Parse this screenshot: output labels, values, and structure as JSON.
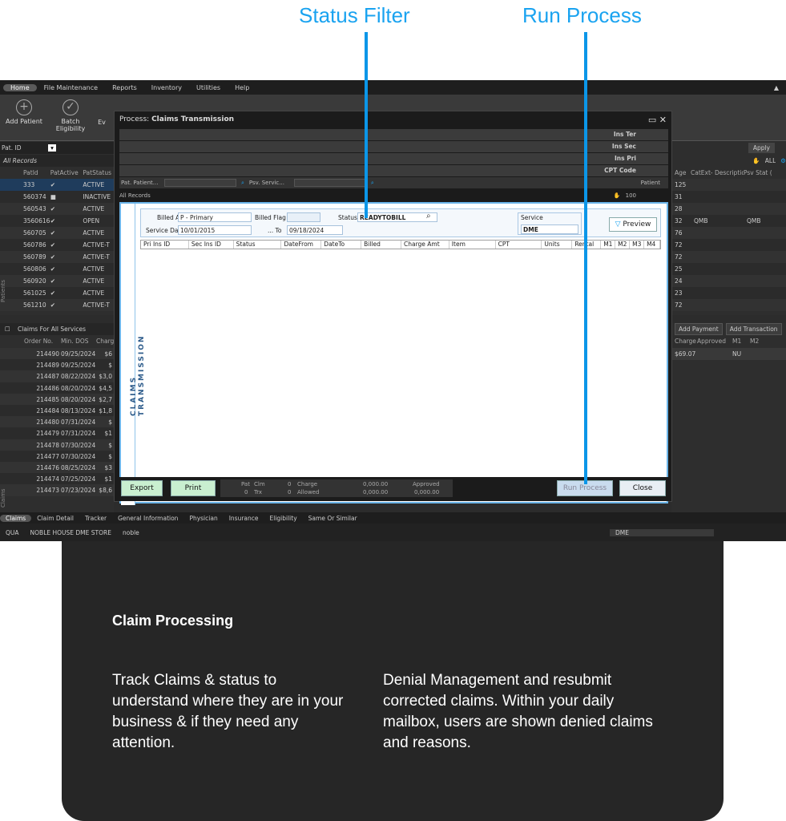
{
  "callouts": {
    "status_filter": "Status Filter",
    "run_process": "Run Process"
  },
  "menu": [
    "Home",
    "File Maintenance",
    "Reports",
    "Inventory",
    "Utilities",
    "Help"
  ],
  "ribbon": [
    "Add Patient",
    "Batch Eligibility",
    "Ev"
  ],
  "patients": {
    "search_label": "Pat. ID",
    "all_records": "All Records",
    "side_label": "Patients",
    "cols": [
      "PatId",
      "PatActive",
      "PatStatus"
    ],
    "rows": [
      [
        "333",
        "✔",
        "ACTIVE"
      ],
      [
        "560374",
        "■",
        "INACTIVE"
      ],
      [
        "560543",
        "✔",
        "ACTIVE"
      ],
      [
        "3560616",
        "✔",
        "OPEN"
      ],
      [
        "560705",
        "✔",
        "ACTIVE"
      ],
      [
        "560786",
        "✔",
        "ACTIVE-T"
      ],
      [
        "560789",
        "✔",
        "ACTIVE-T"
      ],
      [
        "560806",
        "✔",
        "ACTIVE"
      ],
      [
        "560920",
        "✔",
        "ACTIVE"
      ],
      [
        "561025",
        "✔",
        "ACTIVE"
      ],
      [
        "561210",
        "✔",
        "ACTIVE-T"
      ]
    ],
    "right_cols": [
      "Age",
      "CatExt- Description",
      "Psv Stat ("
    ],
    "right_rows": [
      [
        "125",
        "",
        ""
      ],
      [
        "31",
        "",
        ""
      ],
      [
        "28",
        "",
        ""
      ],
      [
        "32",
        "QMB",
        "QMB"
      ],
      [
        "76",
        "",
        ""
      ],
      [
        "72",
        "",
        ""
      ],
      [
        "72",
        "",
        ""
      ],
      [
        "25",
        "",
        ""
      ],
      [
        "24",
        "",
        ""
      ],
      [
        "23",
        "",
        ""
      ],
      [
        "72",
        "",
        ""
      ]
    ],
    "apply": "Apply",
    "all": "ALL"
  },
  "claims": {
    "header": "Claims For All Services",
    "side_label": "Claims",
    "cols": [
      "Order No.",
      "Min. DOS",
      "Charg"
    ],
    "rows": [
      [
        "214490",
        "09/25/2024",
        "$6"
      ],
      [
        "214489",
        "09/25/2024",
        "$"
      ],
      [
        "214487",
        "08/22/2024",
        "$3,0"
      ],
      [
        "214486",
        "08/20/2024",
        "$4,5"
      ],
      [
        "214485",
        "08/20/2024",
        "$2,7"
      ],
      [
        "214484",
        "08/13/2024",
        "$1,8"
      ],
      [
        "214480",
        "07/31/2024",
        "$"
      ],
      [
        "214479",
        "07/31/2024",
        "$1"
      ],
      [
        "214478",
        "07/30/2024",
        "$"
      ],
      [
        "214477",
        "07/30/2024",
        "$"
      ],
      [
        "214476",
        "08/25/2024",
        "$3"
      ],
      [
        "214474",
        "07/25/2024",
        "$1"
      ],
      [
        "214473",
        "07/23/2024",
        "$8,6"
      ]
    ],
    "add_payment": "Add Payment",
    "add_transaction": "Add Transaction",
    "right_cols": [
      "Charge",
      "Approved",
      "M1",
      "M2"
    ],
    "right_row": [
      "$69.07",
      "",
      "NU",
      ""
    ]
  },
  "modal": {
    "title_prefix": "Process:",
    "title": "Claims Transmission",
    "ins": [
      "Ins Ter",
      "Ins Sec",
      "Ins Pri",
      "CPT Code"
    ],
    "pat_patient": "Pat. Patient...",
    "psv_service": "Psv. Servic...",
    "all_records": "All Records",
    "patient": "Patient",
    "count": "100",
    "vertical": "CLAIMS TRANSMISSION",
    "billed_as_label": "Billed As",
    "billed_as": "P - Primary",
    "billed_flag_label": "Billed Flag",
    "status_label": "Status",
    "status": "READYTOBILL",
    "service_date_label": "Service Date",
    "service_date": "10/01/2015",
    "to_label": "... To",
    "to_date": "09/18/2024",
    "service_label": "Service",
    "service": "DME",
    "preview": "Preview",
    "cols": [
      "Pri Ins ID",
      "Sec Ins ID",
      "Status",
      "DateFrom",
      "DateTo",
      "Billed",
      "Charge Amt",
      "Item",
      "CPT",
      "Units",
      "Rental",
      "M1",
      "M2",
      "M3",
      "M4"
    ],
    "export": "Export",
    "print": "Print",
    "pat_label": "Pat",
    "pat_val": "0",
    "clm_label": "Clm",
    "clm_val": "0",
    "trx_label": "Trx",
    "trx_val": "0",
    "charge_label": "Charge",
    "charge_val": "0,000.00",
    "allowed_label": "Allowed",
    "allowed_val": "0,000.00",
    "approved_label": "Approved",
    "approved_val": "0,000.00",
    "run_process": "Run Process",
    "close": "Close"
  },
  "bottom_tabs": [
    "Claims",
    "Claim Detail",
    "Tracker",
    "General Information",
    "Physician",
    "Insurance",
    "Eligibility",
    "Same Or Similar"
  ],
  "status_bar": {
    "a": "QUA",
    "b": "NOBLE HOUSE DME STORE",
    "c": "noble",
    "dme": "DME"
  },
  "card": {
    "title": "Claim Processing",
    "left": "Track Claims & status to understand where they are in your business & if they need any attention.",
    "right": "Denial Management and resubmit corrected claims. Within your daily mailbox, users are shown denied claims and reasons."
  }
}
